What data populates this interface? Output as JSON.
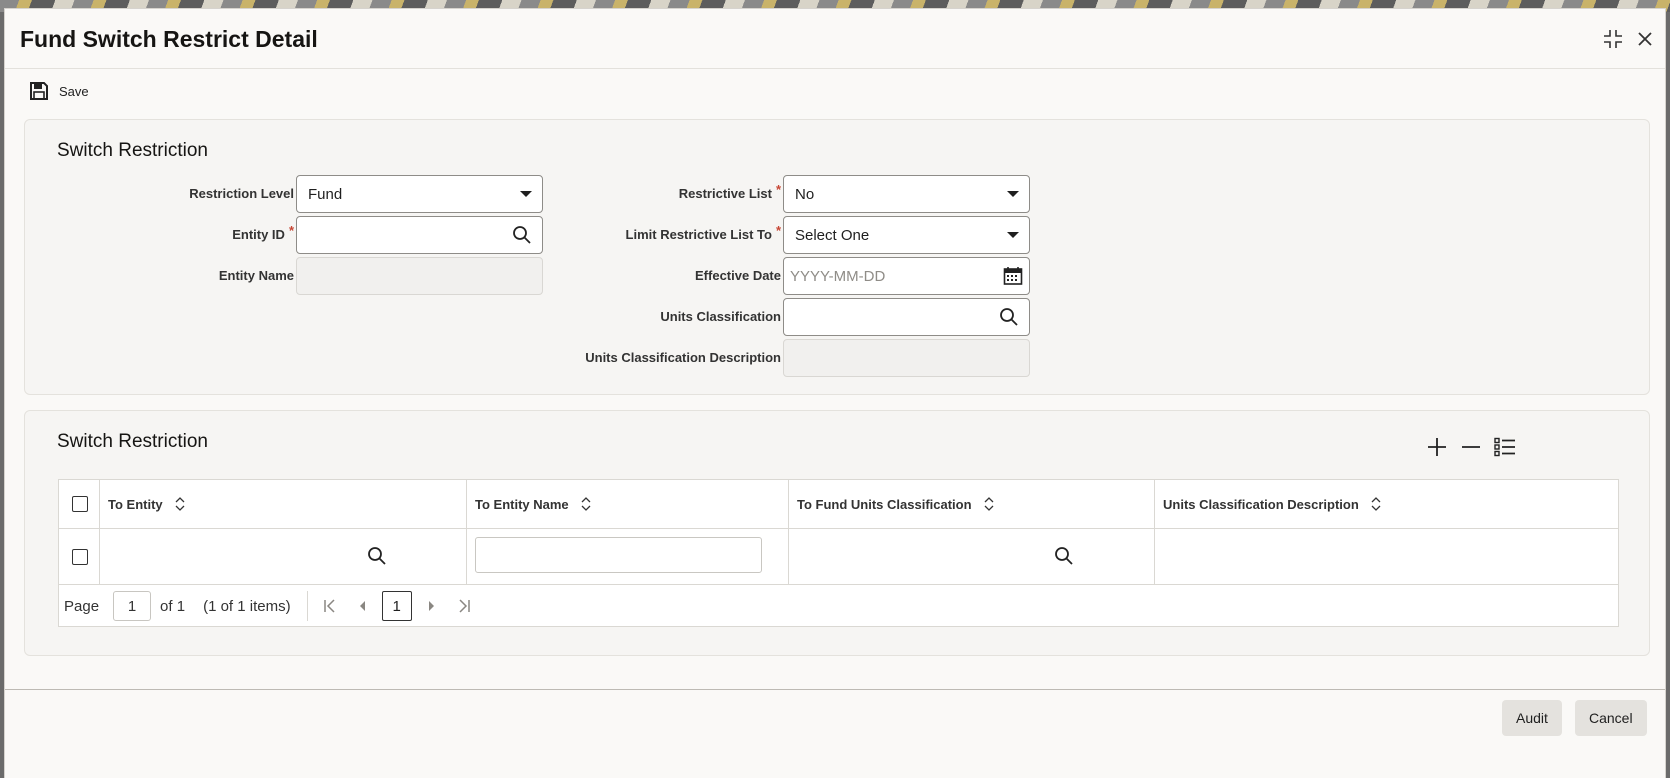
{
  "window": {
    "title": "Fund Switch Restrict Detail"
  },
  "toolbar": {
    "save_label": "Save"
  },
  "form": {
    "section_title": "Switch Restriction",
    "restriction_level": {
      "label": "Restriction Level",
      "value": "Fund"
    },
    "entity_id": {
      "label": "Entity ID",
      "required": "*",
      "value": ""
    },
    "entity_name": {
      "label": "Entity Name",
      "value": ""
    },
    "restrictive_list": {
      "label": "Restrictive List",
      "required": "*",
      "value": "No"
    },
    "limit_restrictive_list_to": {
      "label": "Limit Restrictive List To",
      "required": "*",
      "value": "Select One"
    },
    "effective_date": {
      "label": "Effective Date",
      "placeholder": "YYYY-MM-DD"
    },
    "units_classification": {
      "label": "Units Classification",
      "value": ""
    },
    "units_classification_description": {
      "label": "Units Classification Description",
      "value": ""
    }
  },
  "grid": {
    "section_title": "Switch Restriction",
    "columns": [
      "To Entity",
      "To Entity Name",
      "To Fund Units Classification",
      "Units Classification Description"
    ],
    "pager": {
      "page_label": "Page",
      "page_value": "1",
      "of_label": "of 1",
      "items_label": "(1 of 1 items)",
      "current_page": "1"
    }
  },
  "footer": {
    "audit_label": "Audit",
    "cancel_label": "Cancel"
  }
}
